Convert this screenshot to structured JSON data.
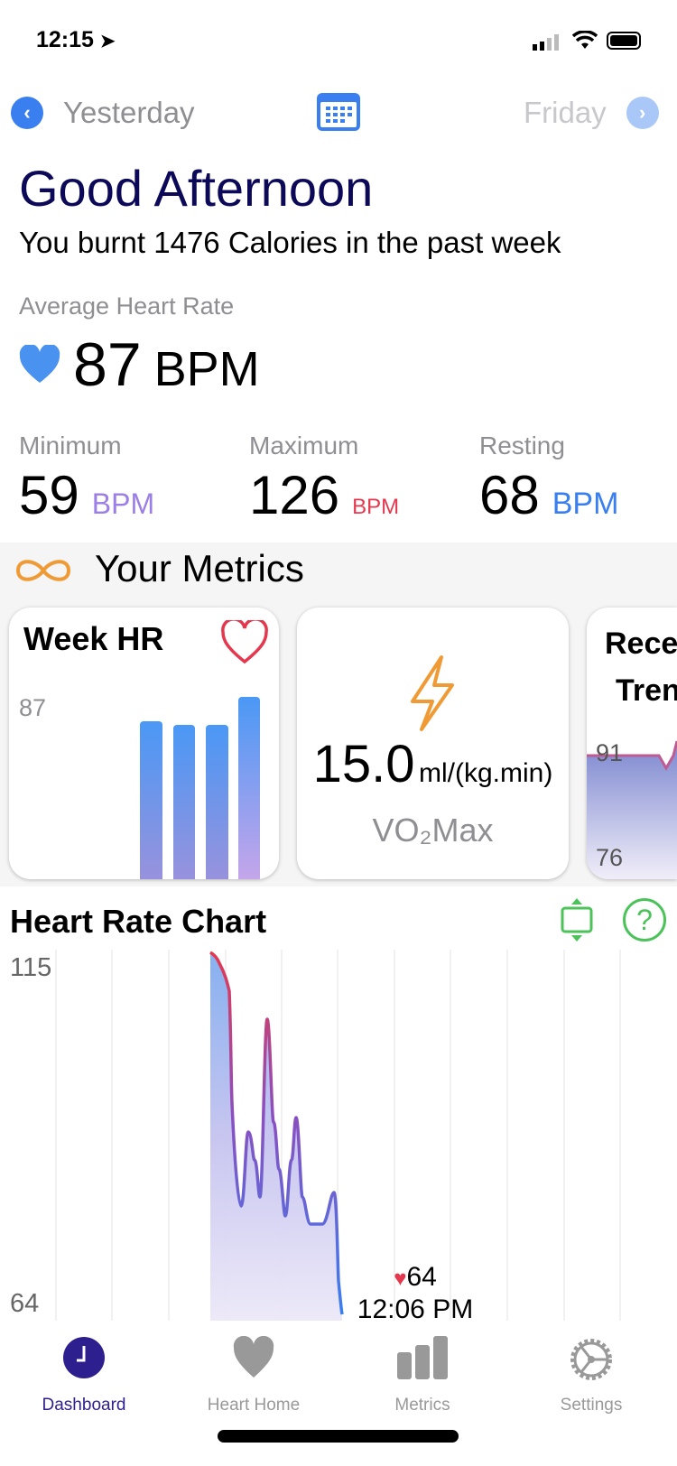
{
  "status": {
    "time": "12:15"
  },
  "nav": {
    "prev": "Yesterday",
    "next": "Friday",
    "icons": [
      "chevron-left-icon",
      "calendar-icon",
      "chevron-right-icon"
    ]
  },
  "greeting": "Good Afternoon",
  "subtitle": "You burnt 1476 Calories in the past week",
  "average": {
    "label": "Average Heart Rate",
    "value": "87",
    "unit": "BPM"
  },
  "stats": [
    {
      "label": "Minimum",
      "value": "59",
      "unit": "BPM",
      "color": "#9b7ee6"
    },
    {
      "label": "Maximum",
      "value": "126",
      "unit": "BPM",
      "color": "#e5384f"
    },
    {
      "label": "Resting",
      "value": "68",
      "unit": "BPM",
      "color": "#3a7ff0"
    }
  ],
  "metrics": {
    "title": "Your Metrics",
    "week_hr": {
      "title": "Week HR",
      "label": "87"
    },
    "vo2": {
      "value": "15.0",
      "unit": "ml/(kg.min)",
      "label": "VO₂Max"
    },
    "trend": {
      "title_line1": "Rece",
      "title_line2": "Tren",
      "high": "91",
      "low": "76"
    }
  },
  "hr_chart": {
    "title": "Heart Rate Chart",
    "y_max": "115",
    "y_min": "64",
    "tooltip_value": "64",
    "tooltip_time": "12:06 PM"
  },
  "tabs": [
    {
      "label": "Dashboard",
      "icon": "clock-icon",
      "active": true
    },
    {
      "label": "Heart Home",
      "icon": "heart-icon"
    },
    {
      "label": "Metrics",
      "icon": "bar-chart-icon"
    },
    {
      "label": "Settings",
      "icon": "gear-icon"
    }
  ],
  "colors": {
    "accent": "#2e1f8f",
    "blue": "#3a7ff0",
    "red": "#e5384f",
    "orange": "#f09a35",
    "green": "#4cc35a"
  }
}
